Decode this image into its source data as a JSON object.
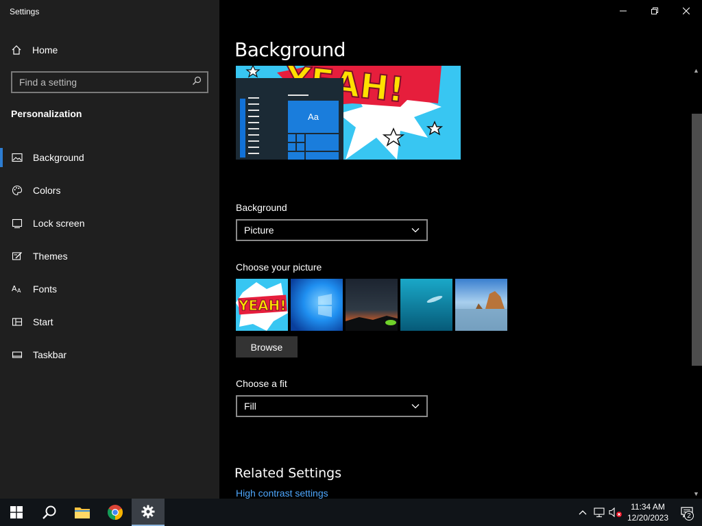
{
  "window": {
    "title": "Settings"
  },
  "sidebar": {
    "home_label": "Home",
    "search_placeholder": "Find a setting",
    "section_title": "Personalization",
    "items": [
      {
        "label": "Background",
        "icon": "picture-icon",
        "active": true
      },
      {
        "label": "Colors",
        "icon": "palette-icon",
        "active": false
      },
      {
        "label": "Lock screen",
        "icon": "lock-screen-icon",
        "active": false
      },
      {
        "label": "Themes",
        "icon": "themes-icon",
        "active": false
      },
      {
        "label": "Fonts",
        "icon": "fonts-icon",
        "active": false
      },
      {
        "label": "Start",
        "icon": "start-icon",
        "active": false
      },
      {
        "label": "Taskbar",
        "icon": "taskbar-icon",
        "active": false
      }
    ]
  },
  "main": {
    "page_title": "Background",
    "preview_tile_text": "Aa",
    "background_label": "Background",
    "background_value": "Picture",
    "choose_picture_label": "Choose your picture",
    "browse_label": "Browse",
    "fit_label": "Choose a fit",
    "fit_value": "Fill",
    "related_title": "Related Settings",
    "related_link": "High contrast settings"
  },
  "taskbar": {
    "time": "11:34 AM",
    "date": "12/20/2023",
    "notification_count": "2"
  },
  "colors": {
    "accent": "#2d7dd2",
    "link": "#4ea8ff",
    "sidebar_bg": "#1f1f1f",
    "main_bg": "#000000"
  }
}
